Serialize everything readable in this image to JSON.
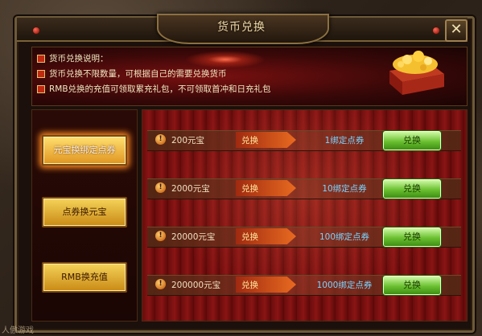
{
  "window": {
    "title": "货币兑换",
    "close_label": "✕"
  },
  "info": {
    "lines": [
      "货币兑换说明：",
      "货币兑换不限数量，可根据自己的需要兑换货币",
      "RMB兑换的充值可领取累充礼包，不可领取首冲和日充礼包"
    ]
  },
  "menu": {
    "items": [
      {
        "label": "元宝换绑定点券",
        "active": true
      },
      {
        "label": "点券换元宝",
        "active": false
      },
      {
        "label": "RMB换充值",
        "active": false
      }
    ]
  },
  "exchange_rows": [
    {
      "cost": "200元宝",
      "arrow_label": "兑换",
      "gain": "1绑定点券",
      "button": "兑换"
    },
    {
      "cost": "2000元宝",
      "arrow_label": "兑换",
      "gain": "10绑定点券",
      "button": "兑换"
    },
    {
      "cost": "20000元宝",
      "arrow_label": "兑换",
      "gain": "100绑定点券",
      "button": "兑换"
    },
    {
      "cost": "200000元宝",
      "arrow_label": "兑换",
      "gain": "1000绑定点券",
      "button": "兑换"
    }
  ],
  "watermark": "人傲游戏",
  "colors": {
    "accent_gold": "#f5d35a",
    "button_green": "#6ac030",
    "gain_text": "#7ad4ff",
    "info_text": "#f0e6c0"
  },
  "icons": {
    "close": "close-icon",
    "info_bullet": "checkbox-icon",
    "row_marker": "warning-icon",
    "treasure": "treasure-chest-icon"
  }
}
